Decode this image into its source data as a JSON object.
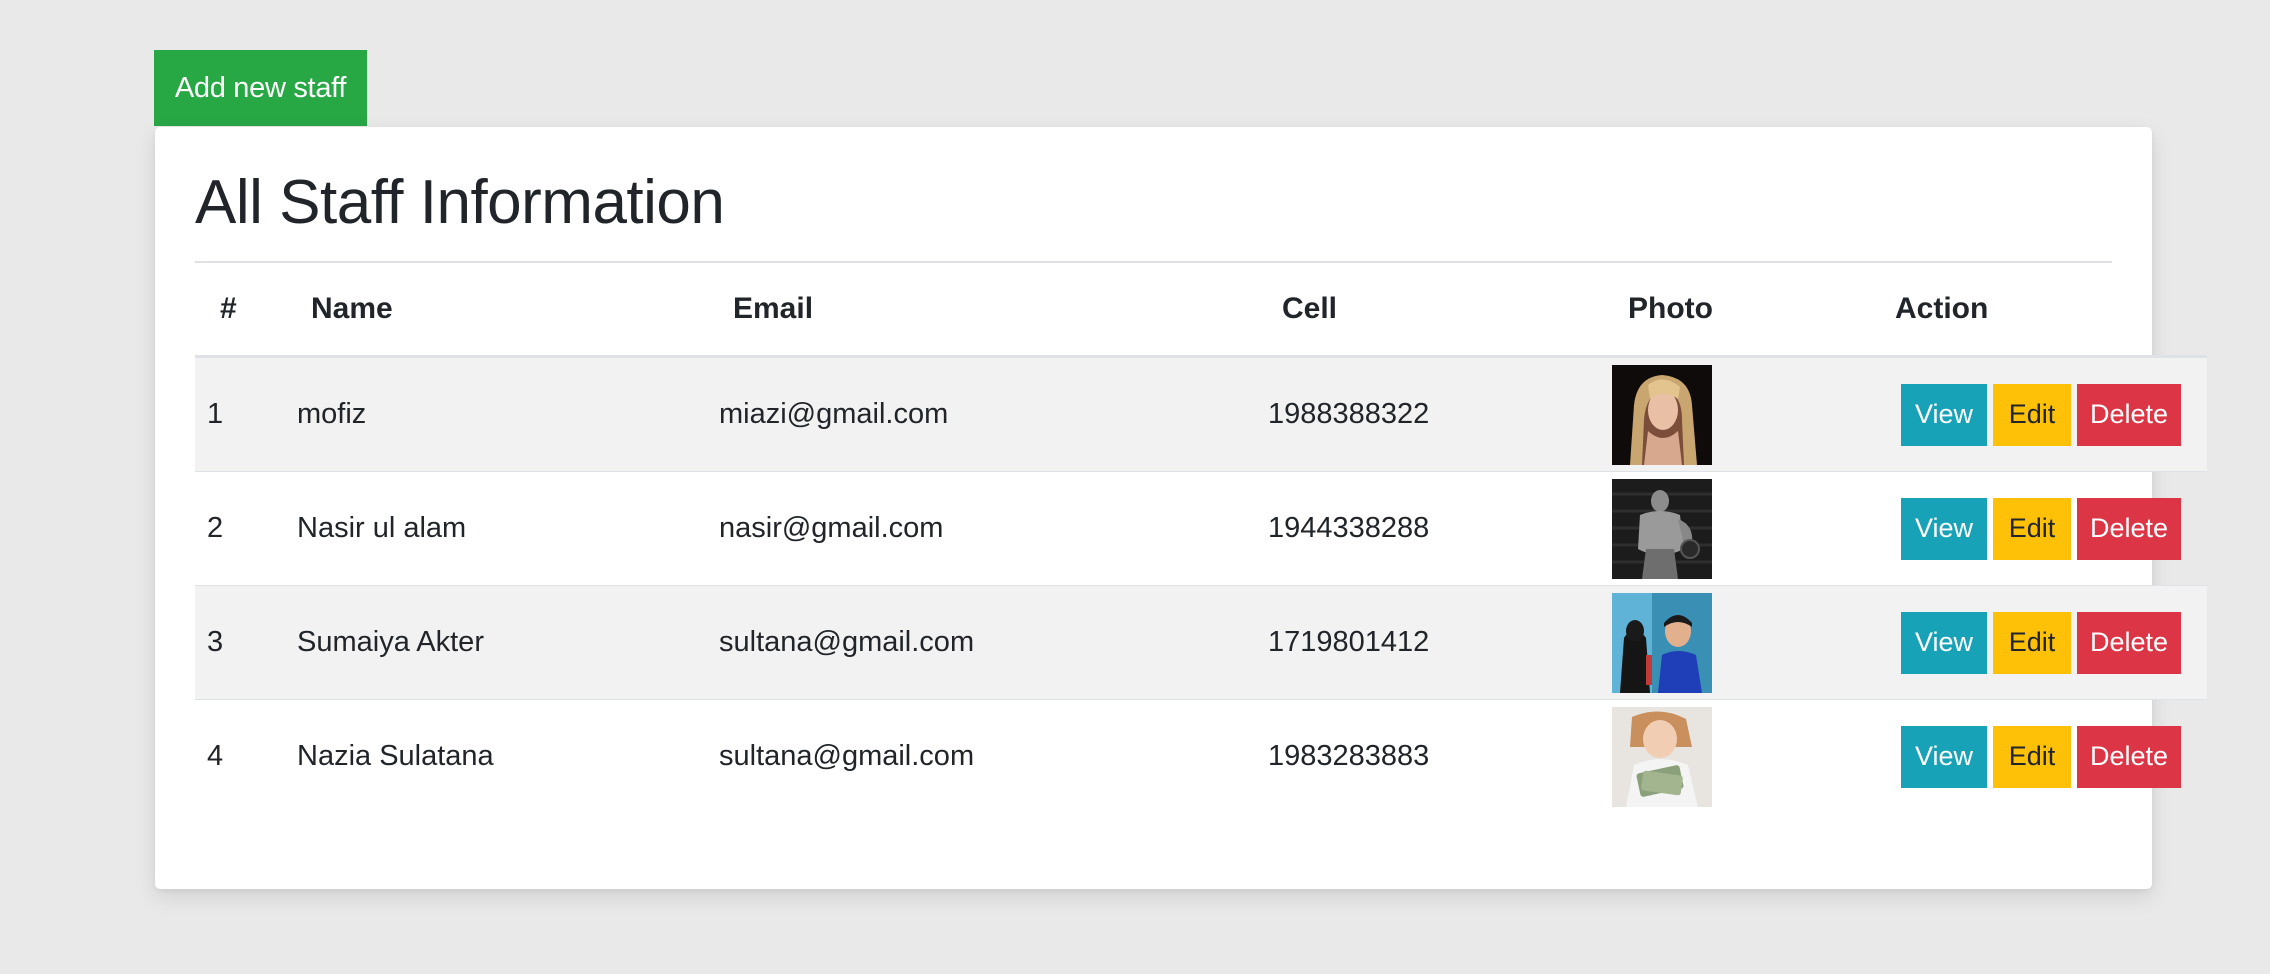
{
  "toolbar": {
    "add_label": "Add new staff"
  },
  "card": {
    "title": "All Staff Information"
  },
  "table": {
    "headers": [
      "#",
      "Name",
      "Email",
      "Cell",
      "Photo",
      "Action"
    ],
    "actions": {
      "view": "View",
      "edit": "Edit",
      "delete": "Delete"
    },
    "rows": [
      {
        "num": "1",
        "name": "mofiz",
        "email": "miazi@gmail.com",
        "cell": "1988388322",
        "photo": "blonde-woman-portrait"
      },
      {
        "num": "2",
        "name": "Nasir ul alam",
        "email": "nasir@gmail.com",
        "cell": "1944338288",
        "photo": "bodybuilder-with-dumbbell"
      },
      {
        "num": "3",
        "name": "Sumaiya Akter",
        "email": "sultana@gmail.com",
        "cell": "1719801412",
        "photo": "couple-selfie"
      },
      {
        "num": "4",
        "name": "Nazia Sulatana",
        "email": "sultana@gmail.com",
        "cell": "1983283883",
        "photo": "child-with-cash"
      }
    ]
  },
  "colors": {
    "background": "#e9e9e9",
    "success": "#28a745",
    "info": "#17a2b8",
    "warning": "#ffc107",
    "danger": "#dc3545"
  }
}
